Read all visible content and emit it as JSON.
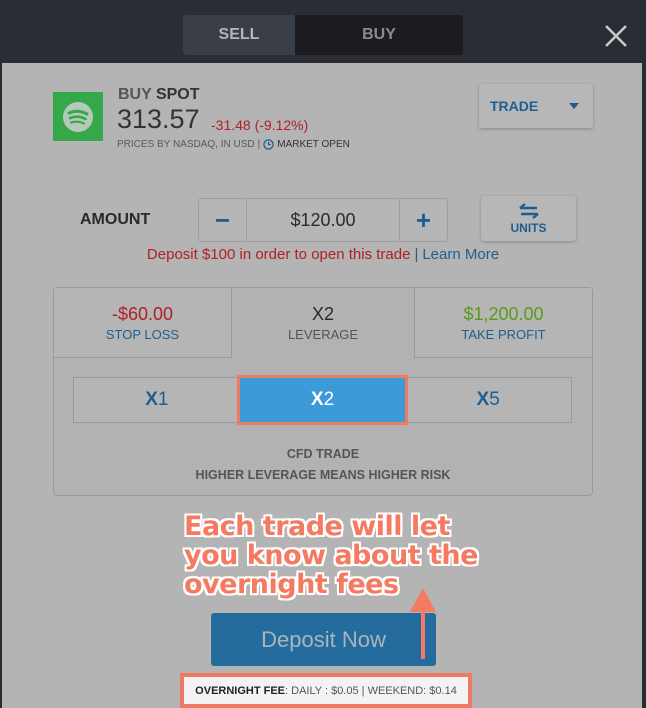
{
  "header": {
    "tabs": [
      {
        "label": "SELL",
        "active": true
      },
      {
        "label": "BUY",
        "active": false
      }
    ],
    "close_icon": "close-icon"
  },
  "instrument": {
    "logo_icon": "spotify-logo-icon",
    "action": "BUY",
    "symbol": "SPOT",
    "price": "313.57",
    "change": "-31.48 (-9.12%)",
    "source": "PRICES BY NASDAQ, IN USD",
    "separator": "|",
    "market_status": "MARKET OPEN",
    "status_icon": "clock-icon"
  },
  "order_type": {
    "selected": "TRADE"
  },
  "amount": {
    "label": "AMOUNT",
    "value": "$120.00",
    "minus": "−",
    "plus": "+",
    "units_label": "UNITS"
  },
  "deposit_notice": {
    "message": "Deposit $100 in order to open this trade",
    "separator": "|",
    "link": "Learn More"
  },
  "leverage": {
    "stop_loss": {
      "value": "-$60.00",
      "label": "STOP LOSS"
    },
    "current": {
      "value": "X2",
      "label": "LEVERAGE"
    },
    "take_profit": {
      "value": "$1,200.00",
      "label": "TAKE PROFIT"
    },
    "options": [
      {
        "prefix": "X",
        "num": "1",
        "selected": false
      },
      {
        "prefix": "X",
        "num": "2",
        "selected": true
      },
      {
        "prefix": "X",
        "num": "5",
        "selected": false
      }
    ],
    "note_line1": "CFD TRADE",
    "note_line2": "HIGHER LEVERAGE MEANS HIGHER RISK"
  },
  "annotation": {
    "line1": "Each trade will let",
    "line2": "you know about the",
    "line3": "overnight fees",
    "color": "#f47b62"
  },
  "deposit_button": "Deposit Now",
  "overnight_fee": {
    "label": "OVERNIGHT FEE",
    "text": ": DAILY : $0.05 | WEEKEND: $0.14"
  },
  "colors": {
    "accent_blue": "#1f5e8f",
    "selected_blue": "#3d9ad9",
    "loss_red": "#b02025",
    "profit_green": "#5a9a1c",
    "spotify_green": "#35a84a",
    "highlight": "#ef7a64"
  }
}
